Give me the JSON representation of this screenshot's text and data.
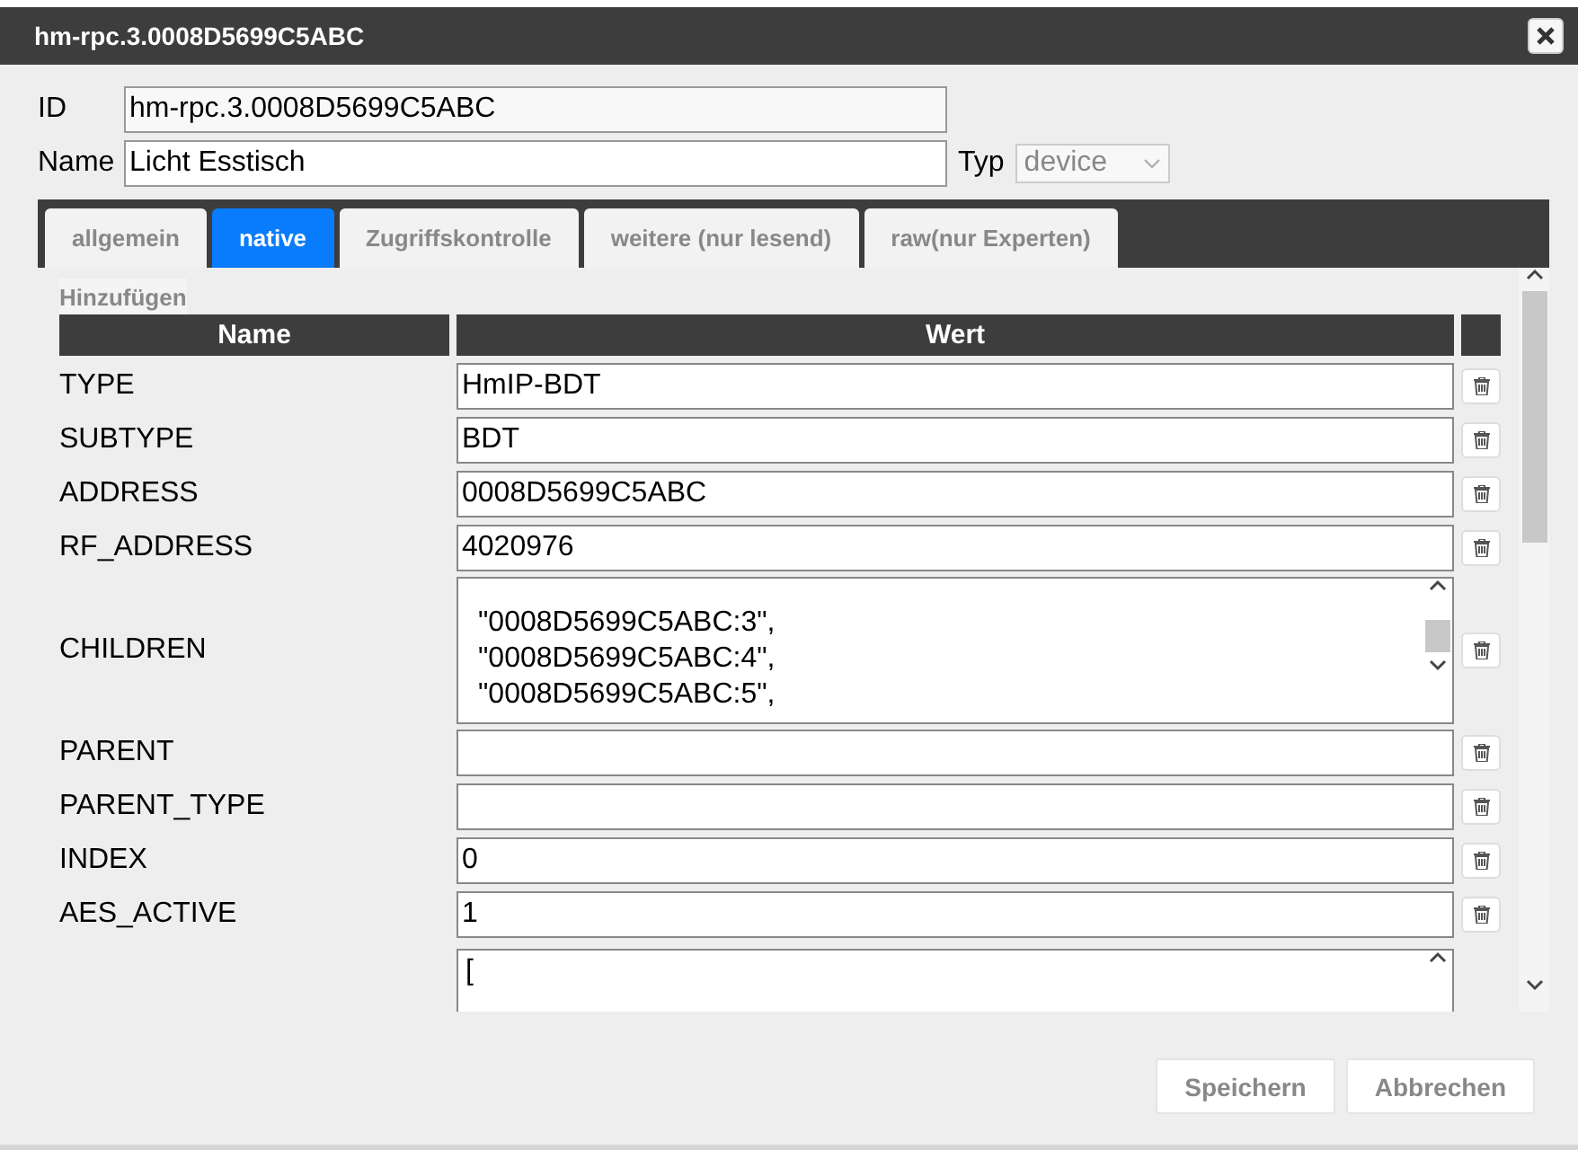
{
  "window": {
    "title": "hm-rpc.3.0008D5699C5ABC"
  },
  "fields": {
    "id_label": "ID",
    "id_value": "hm-rpc.3.0008D5699C5ABC",
    "name_label": "Name",
    "name_value": "Licht Esstisch",
    "type_label": "Typ",
    "type_value": "device"
  },
  "tabs": [
    {
      "label": "allgemein",
      "selected": false
    },
    {
      "label": "native",
      "selected": true
    },
    {
      "label": "Zugriffskontrolle",
      "selected": false
    },
    {
      "label": "weitere (nur lesend)",
      "selected": false
    },
    {
      "label": "raw(nur Experten)",
      "selected": false
    }
  ],
  "add_button": "Hinzufügen",
  "table": {
    "columns": [
      "Name",
      "Wert"
    ],
    "rows": [
      {
        "kind": "input",
        "name": "TYPE",
        "value": "HmIP-BDT"
      },
      {
        "kind": "input",
        "name": "SUBTYPE",
        "value": "BDT"
      },
      {
        "kind": "input",
        "name": "ADDRESS",
        "value": "0008D5699C5ABC"
      },
      {
        "kind": "input",
        "name": "RF_ADDRESS",
        "value": "4020976"
      },
      {
        "kind": "textarea",
        "name": "CHILDREN",
        "lines": [
          "\"0008D5699C5ABC:3\",",
          "\"0008D5699C5ABC:4\",",
          "\"0008D5699C5ABC:5\","
        ]
      },
      {
        "kind": "input",
        "name": "PARENT",
        "value": ""
      },
      {
        "kind": "input",
        "name": "PARENT_TYPE",
        "value": ""
      },
      {
        "kind": "input",
        "name": "INDEX",
        "value": "0"
      },
      {
        "kind": "input",
        "name": "AES_ACTIVE",
        "value": "1"
      },
      {
        "kind": "partial",
        "name": "",
        "lines": [
          "["
        ]
      }
    ]
  },
  "buttons": [
    "Speichern",
    "Abbrechen"
  ]
}
